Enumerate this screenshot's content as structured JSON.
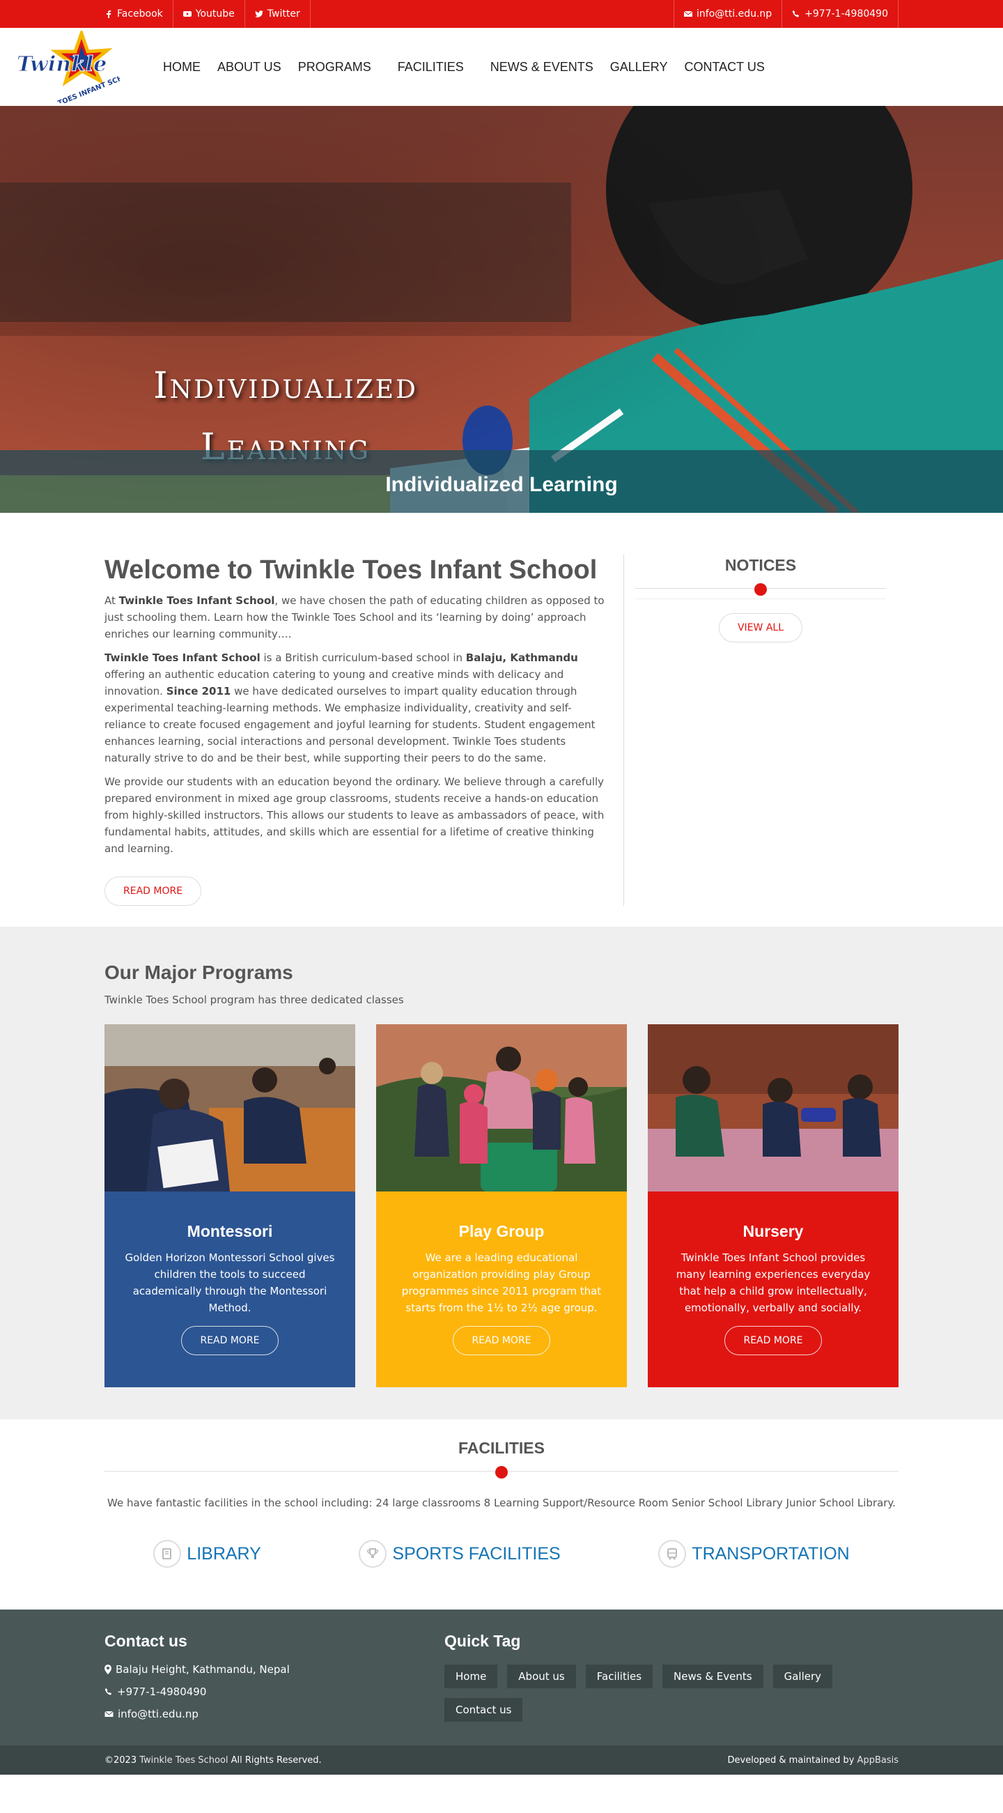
{
  "topbar": {
    "facebook": "Facebook",
    "youtube": "Youtube",
    "twitter": "Twitter",
    "email": "info@tti.edu.np",
    "phone": "+977-1-4980490"
  },
  "logo": {
    "word": "Twinkle",
    "sub": "TOES INFANT SCHOOL"
  },
  "nav": [
    {
      "label": "HOME"
    },
    {
      "label": "ABOUT US"
    },
    {
      "label": "PROGRAMS"
    },
    {
      "label": "FACILITIES"
    },
    {
      "label": "NEWS & EVENTS"
    },
    {
      "label": "GALLERY"
    },
    {
      "label": "CONTACT US"
    }
  ],
  "hero": {
    "title_line1": "Individualized",
    "title_line2": "Learning",
    "caption": "Individualized Learning"
  },
  "welcome": {
    "title": "Welcome to Twinkle Toes Infant School",
    "p1_a": "At ",
    "p1_b": "Twinkle Toes Infant School",
    "p1_c": ", we have chosen the path of educating children as opposed to just schooling them. Learn how the Twinkle Toes School and its ‘learning by doing’ approach enriches our learning community….",
    "p2_a": "Twinkle Toes Infant School",
    "p2_b": " is a British curriculum-based school in ",
    "p2_c": "Balaju, Kathmandu",
    "p2_d": " offering an authentic education catering to young and creative minds with delicacy and innovation. ",
    "p2_e": "Since 2011",
    "p2_f": " we have dedicated ourselves to impart quality education through experimental teaching-learning methods. We emphasize individuality, creativity and self-reliance to create focused engagement and joyful learning for students. Student engagement enhances learning, social interactions and personal development. Twinkle Toes students naturally strive to do and be their best, while supporting their peers to do the same.",
    "p3": "We provide our students with an education beyond the ordinary. We believe through a carefully prepared environment in mixed age group classrooms, students receive a hands-on education from highly-skilled instructors. This allows our students to leave as ambassadors of peace, with fundamental habits, attitudes, and skills which are essential for a lifetime of creative thinking and learning.",
    "read_more": "READ MORE"
  },
  "notices": {
    "title": "NOTICES",
    "view_all": "VIEW ALL"
  },
  "programs": {
    "title": "Our Major Programs",
    "subtitle": "Twinkle Toes School program has three dedicated classes",
    "cards": [
      {
        "title": "Montessori",
        "text": "Golden Horizon Montessori School gives children the tools to succeed academically through the Montessori Method.",
        "button": "READ MORE",
        "color": "#2c5593"
      },
      {
        "title": "Play Group",
        "text": "We are a leading educational organization providing play Group programmes since 2011 program that starts from the 1½ to 2½ age group.",
        "button": "READ MORE",
        "color": "#fdb50b"
      },
      {
        "title": "Nursery",
        "text": "Twinkle Toes Infant School provides many learning experiences everyday that help a child grow intellectually, emotionally, verbally and socially.",
        "button": "READ MORE",
        "color": "#e01512"
      }
    ]
  },
  "facilities": {
    "title": "FACILITIES",
    "text": "We have fantastic facilities in the school including: 24 large classrooms 8 Learning Support/Resource Room Senior School Library Junior School Library.",
    "items": [
      {
        "label": "LIBRARY",
        "icon": "book-icon"
      },
      {
        "label": "SPORTS FACILITIES",
        "icon": "trophy-icon"
      },
      {
        "label": "TRANSPORTATION",
        "icon": "bus-icon"
      }
    ]
  },
  "footer": {
    "contact_title": "Contact us",
    "address": "Balaju Height, Kathmandu, Nepal",
    "phone": "+977-1-4980490",
    "email": "info@tti.edu.np",
    "quick_title": "Quick Tag",
    "tags": [
      "Home",
      "About us",
      "Facilities",
      "News & Events",
      "Gallery",
      "Contact us"
    ],
    "copyright_a": "©2023 ",
    "copyright_b": "Twinkle Toes School",
    "copyright_c": " All Rights Reserved.",
    "dev_a": "Developed & maintained by ",
    "dev_b": "AppBasis"
  },
  "colors": {
    "brand_red": "#e01512",
    "blue": "#2c5593",
    "yellow": "#fdb50b",
    "link_blue": "#1474b4",
    "footer": "#495757"
  }
}
